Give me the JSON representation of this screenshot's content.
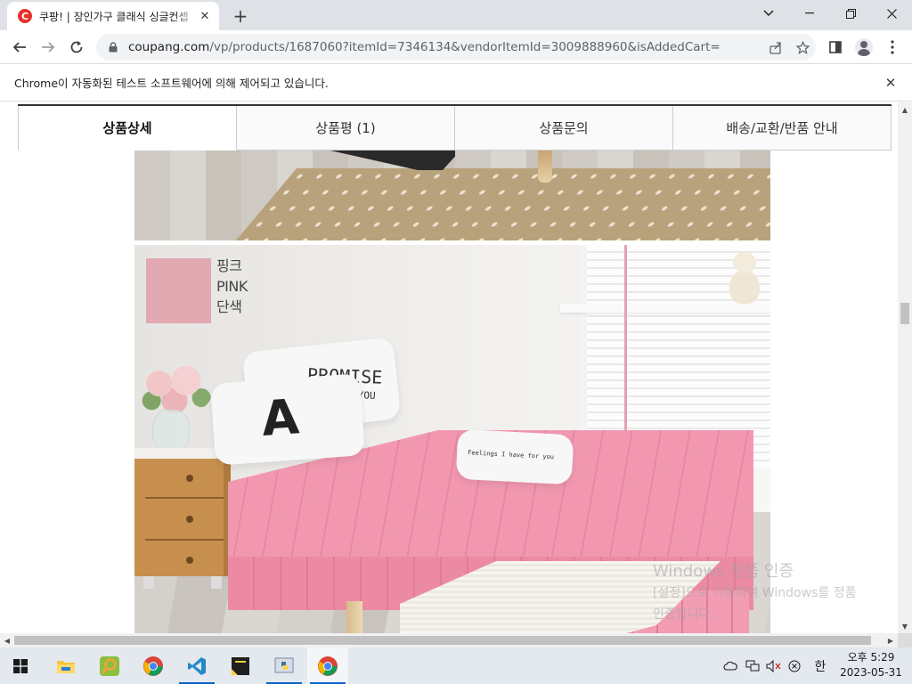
{
  "browser": {
    "tab": {
      "favicon_letter": "C",
      "title": "쿠팡! | 장인가구 클래식 싱글컨셉"
    },
    "url": {
      "host": "coupang.com",
      "path": "/vp/products/1687060?itemId=7346134&vendorItemId=3009888960&isAddedCart="
    },
    "infobar_text": "Chrome이 자동화된 테스트 소프트웨어에 의해 제어되고 있습니다."
  },
  "page": {
    "product_tabs": [
      {
        "label": "상품상세",
        "active": true
      },
      {
        "label": "상품평 (1)",
        "active": false
      },
      {
        "label": "상품문의",
        "active": false
      },
      {
        "label": "배송/교환/반품 안내",
        "active": false
      }
    ],
    "swatch": {
      "color": "#e2a9b3",
      "label_ko": "핑크",
      "label_en": "PINK",
      "label_type": "단색"
    },
    "pillows": {
      "a_letter": "A",
      "promise_text": "PROMISE",
      "promise_sub": "FOR YOU",
      "small_text": "Feelings I have for you"
    }
  },
  "watermark": {
    "line1": "Windows 정품 인증",
    "line2": "[설정]으로 이동하여 Windows를 정품",
    "line3": "인증합니다."
  },
  "taskbar": {
    "ime": "한",
    "time": "오후 5:29",
    "date": "2023-05-31"
  },
  "colors": {
    "accent_blue": "#0a64c8",
    "coupang_red": "#e5322d",
    "bed_pink": "#ec8aa4"
  }
}
